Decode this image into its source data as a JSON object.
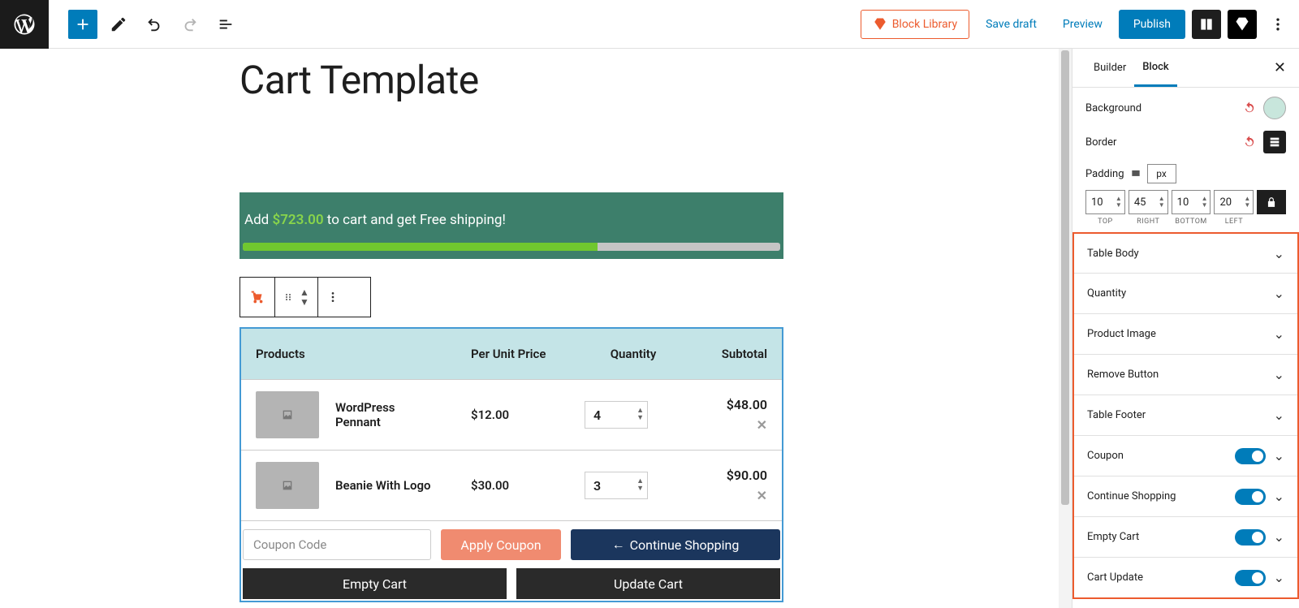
{
  "toolbar": {
    "block_library": "Block Library",
    "save_draft": "Save draft",
    "preview": "Preview",
    "publish": "Publish"
  },
  "page": {
    "title": "Cart Template"
  },
  "ship": {
    "prefix": "Add ",
    "amount": "$723.00",
    "suffix": " to cart and get Free shipping!"
  },
  "table": {
    "head": {
      "products": "Products",
      "price": "Per Unit Price",
      "qty": "Quantity",
      "sub": "Subtotal"
    },
    "rows": [
      {
        "name": "WordPress Pennant",
        "price": "$12.00",
        "qty": "4",
        "sub": "$48.00"
      },
      {
        "name": "Beanie With Logo",
        "price": "$30.00",
        "qty": "3",
        "sub": "$90.00"
      }
    ],
    "coupon_placeholder": "Coupon Code",
    "apply": "Apply Coupon",
    "continue": "Continue Shopping",
    "empty": "Empty Cart",
    "update": "Update Cart"
  },
  "sidebar": {
    "tabs": {
      "builder": "Builder",
      "block": "Block"
    },
    "background": "Background",
    "border": "Border",
    "padding": "Padding",
    "unit": "px",
    "pad": {
      "top": "10",
      "right": "45",
      "bottom": "10",
      "left": "20"
    },
    "pad_lbl": {
      "top": "TOP",
      "right": "RIGHT",
      "bottom": "BOTTOM",
      "left": "LEFT"
    },
    "accordions": [
      {
        "label": "Table Body",
        "toggle": false
      },
      {
        "label": "Quantity",
        "toggle": false
      },
      {
        "label": "Product Image",
        "toggle": false
      },
      {
        "label": "Remove Button",
        "toggle": false
      },
      {
        "label": "Table Footer",
        "toggle": false
      },
      {
        "label": "Coupon",
        "toggle": true
      },
      {
        "label": "Continue Shopping",
        "toggle": true
      },
      {
        "label": "Empty Cart",
        "toggle": true
      },
      {
        "label": "Cart Update",
        "toggle": true
      }
    ]
  }
}
